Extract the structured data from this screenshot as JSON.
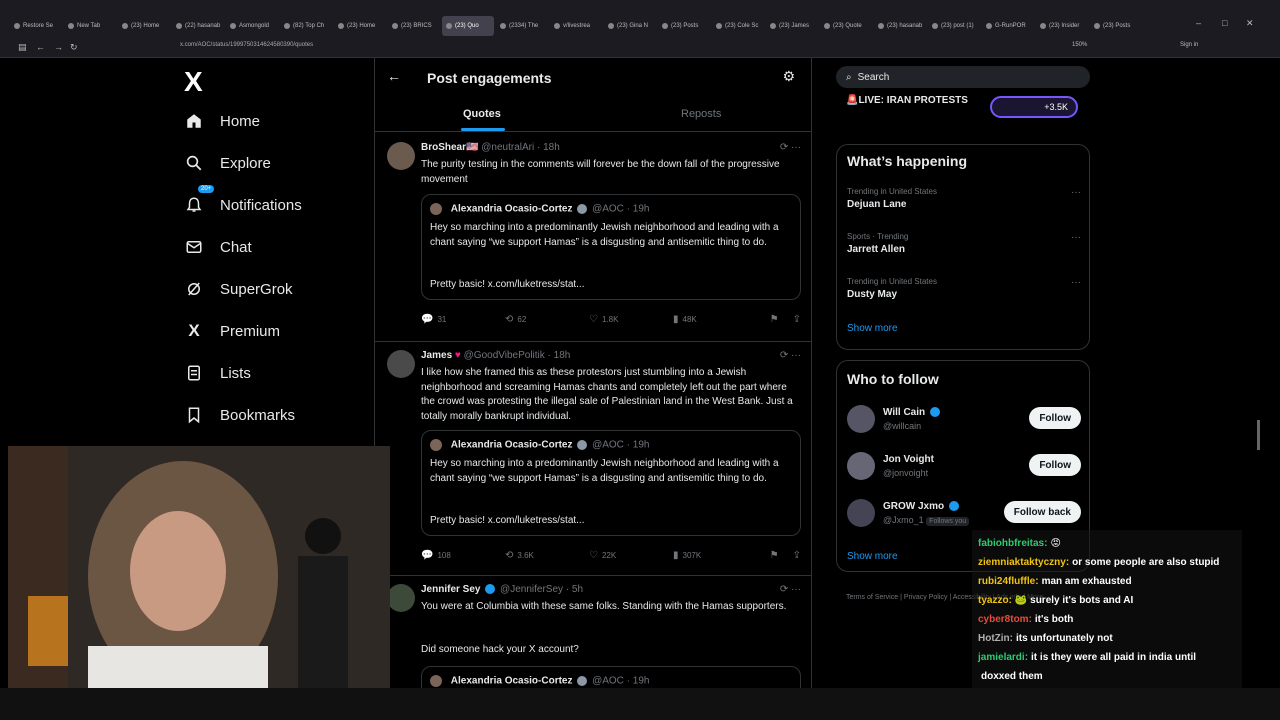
{
  "browser": {
    "tabs": [
      "Restore Se",
      "New Tab",
      "(23) Home",
      "(22) hasanab",
      "Asmongold",
      "(82) Top Ch",
      "(23) Home",
      "(23) BRICS",
      "(23) Quo",
      "(2334) The",
      "v/livestrea",
      "(23) Gina N",
      "(23) Posts",
      "(23) Cole Sc",
      "(23) James",
      "(23) Quote",
      "(23) hasanab",
      "(23) post (1)",
      "G-RunPOR",
      "(23) Insider",
      "(23) Posts"
    ],
    "url": "x.com/AOC/status/1999750314624580390/quotes",
    "zoom": "150%",
    "signin": "Sign in"
  },
  "nav": {
    "logo": "X",
    "items": [
      {
        "label": "Home",
        "icon": "home-icon"
      },
      {
        "label": "Explore",
        "icon": "search-icon"
      },
      {
        "label": "Notifications",
        "icon": "bell-icon",
        "badge": "20+"
      },
      {
        "label": "Chat",
        "icon": "mail-icon"
      },
      {
        "label": "SuperGrok",
        "icon": "grok-icon"
      },
      {
        "label": "Premium",
        "icon": "x-icon"
      },
      {
        "label": "Lists",
        "icon": "list-icon"
      },
      {
        "label": "Bookmarks",
        "icon": "bookmark-icon"
      }
    ]
  },
  "center": {
    "title": "Post engagements",
    "tabs": [
      "Quotes",
      "Reposts"
    ],
    "posts": [
      {
        "name": "BroShear🇺🇸",
        "meta": "@neutralAri · 18h",
        "text": "The purity testing in the comments will forever be the down fall of the progressive movement",
        "quote": {
          "name": "Alexandria Ocasio-Cortez",
          "meta": "@AOC · 19h",
          "text": "Hey so marching into a predominantly Jewish neighborhood and leading with a chant saying “we support Hamas” is a disgusting and antisemitic thing to do.",
          "link": "Pretty basic! x.com/luketress/stat..."
        },
        "stats": {
          "replies": "31",
          "reposts": "62",
          "likes": "1.8K",
          "views": "48K"
        }
      },
      {
        "name": "James",
        "meta": "@GoodVibePolitik · 18h",
        "text": "I like how she framed this as these protestors just stumbling into a Jewish neighborhood and screaming Hamas chants and completely left out the part where the crowd was protesting the illegal sale of Palestinian land in the West Bank. Just a totally morally bankrupt individual.",
        "quote": {
          "name": "Alexandria Ocasio-Cortez",
          "meta": "@AOC · 19h",
          "text": "Hey so marching into a predominantly Jewish neighborhood and leading with a chant saying “we support Hamas” is a disgusting and antisemitic thing to do.",
          "link": "Pretty basic! x.com/luketress/stat..."
        },
        "stats": {
          "replies": "108",
          "reposts": "3.6K",
          "likes": "22K",
          "views": "307K"
        }
      },
      {
        "name": "Jennifer Sey",
        "meta": "@JenniferSey · 5h",
        "text": "You were at Columbia with these same folks. Standing with the Hamas supporters.",
        "text2": "Did someone hack your X account?",
        "quote": {
          "name": "Alexandria Ocasio-Cortez",
          "meta": "@AOC · 19h"
        }
      }
    ]
  },
  "right": {
    "search_placeholder": "Search",
    "live": "🚨LIVE: IRAN PROTESTS",
    "live_count": "+3.5K",
    "happening_title": "What’s happening",
    "trends": [
      {
        "meta": "Trending in United States",
        "name": "Dejuan Lane"
      },
      {
        "meta": "Sports · Trending",
        "name": "Jarrett Allen"
      },
      {
        "meta": "Trending in United States",
        "name": "Dusty May"
      }
    ],
    "show_more": "Show more",
    "follow_title": "Who to follow",
    "follows": [
      {
        "name": "Will Cain",
        "handle": "@willcain",
        "button": "Follow"
      },
      {
        "name": "Jon Voight",
        "handle": "@jonvoight",
        "button": "Follow"
      },
      {
        "name": "GROW Jxmo",
        "handle": "@Jxmo_1",
        "tag": "Follows you",
        "button": "Follow back"
      }
    ],
    "footer": "Terms of Service | Privacy Policy | Accessibility | Ads info | More ···"
  },
  "chat": [
    {
      "user": "fabiohbfreitas:",
      "msg": "😡",
      "color": "#2ecc71"
    },
    {
      "user": "ziemniaktaktyczny:",
      "msg": "or some people are also stupid",
      "color": "#f1c40f"
    },
    {
      "user": "rubi24fluffle:",
      "msg": "man am exhausted",
      "color": "#f1c40f"
    },
    {
      "user": "tyazzo:",
      "msg": "🐸 surely it's bots and AI",
      "color": "#f1c40f"
    },
    {
      "user": "cyber8tom:",
      "msg": "it's both",
      "color": "#e74c3c"
    },
    {
      "user": "HotZin:",
      "msg": "its unfortunately not",
      "color": "#b0b0b0"
    },
    {
      "user": "jamielardi:",
      "msg": "it is they were all paid in india until",
      "color": "#2ecc71"
    },
    {
      "user": "",
      "msg": "doxxed them",
      "color": "#fff"
    }
  ]
}
